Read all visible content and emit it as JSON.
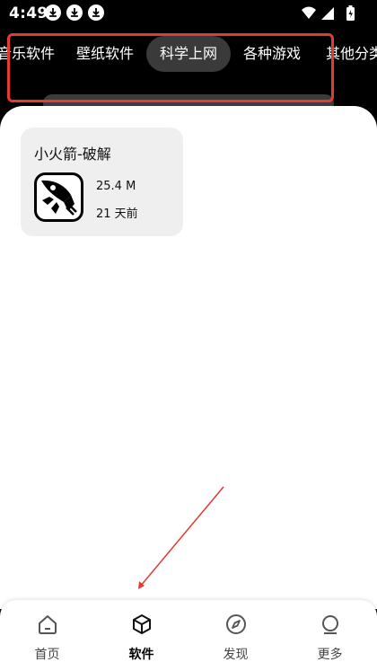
{
  "status_bar": {
    "time": "4:49",
    "icons": [
      "download-icon",
      "download-icon",
      "download-icon",
      "wifi-icon",
      "signal-icon",
      "battery-icon"
    ]
  },
  "category_tabs": [
    {
      "label": "音乐软件",
      "active": false
    },
    {
      "label": "壁纸软件",
      "active": false
    },
    {
      "label": "科学上网",
      "active": true
    },
    {
      "label": "各种游戏",
      "active": false
    },
    {
      "label": "其他分类",
      "active": false
    }
  ],
  "apps": [
    {
      "name": "小火箭-破解",
      "size": "25.4 M",
      "updated": "21 天前",
      "icon": "rocket-icon"
    }
  ],
  "bottom_nav": [
    {
      "label": "首页",
      "icon": "home-icon",
      "active": false
    },
    {
      "label": "软件",
      "icon": "box-icon",
      "active": true
    },
    {
      "label": "发现",
      "icon": "compass-icon",
      "active": false
    },
    {
      "label": "更多",
      "icon": "more-icon",
      "active": false
    }
  ],
  "colors": {
    "annotation_red": "#e53935",
    "active_tab_bg": "#3a3a3a",
    "card_bg": "#efefef"
  }
}
